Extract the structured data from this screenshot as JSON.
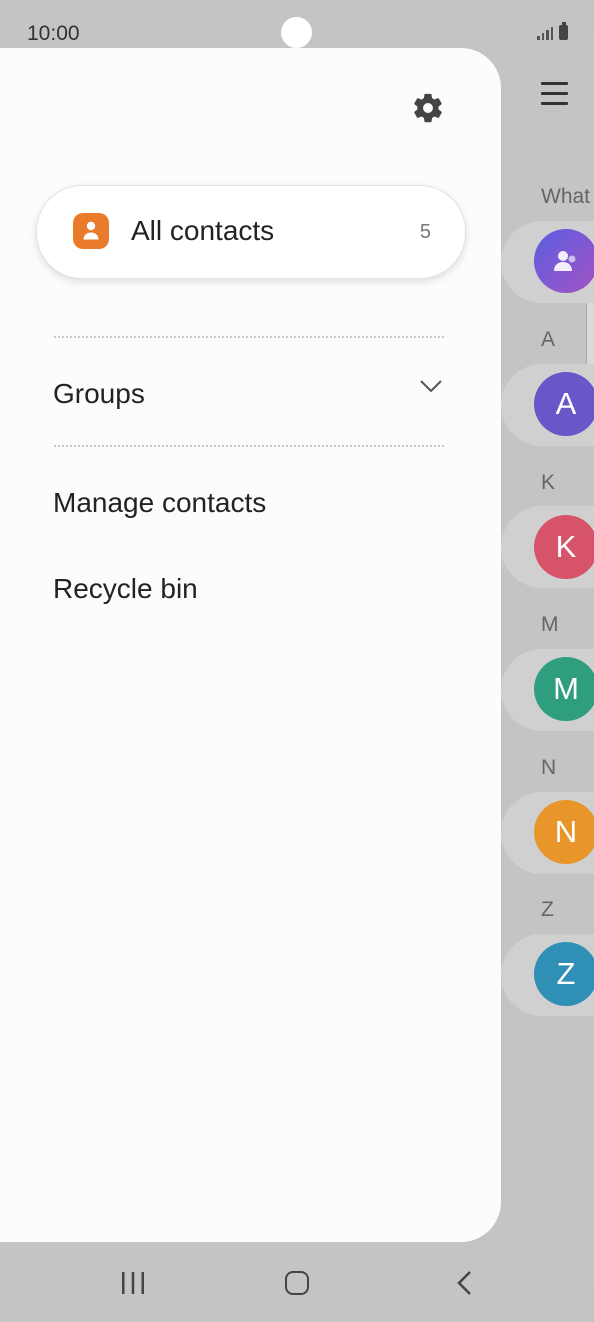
{
  "status_bar": {
    "time": "10:00"
  },
  "background_list": {
    "sections": [
      {
        "label": "What",
        "avatar_letter": "",
        "avatar_color": "#7a58cf"
      },
      {
        "label": "A",
        "avatar_letter": "A",
        "avatar_color": "#6a55c9"
      },
      {
        "label": "K",
        "avatar_letter": "K",
        "avatar_color": "#d6536a"
      },
      {
        "label": "M",
        "avatar_letter": "M",
        "avatar_color": "#2f9e7e"
      },
      {
        "label": "N",
        "avatar_letter": "N",
        "avatar_color": "#e8962a"
      },
      {
        "label": "Z",
        "avatar_letter": "Z",
        "avatar_color": "#2f8fb5"
      }
    ]
  },
  "drawer": {
    "all_contacts": {
      "label": "All contacts",
      "count": "5",
      "icon": "person-icon",
      "icon_color": "#ea7b2a"
    },
    "groups": {
      "label": "Groups",
      "icon": "chevron-down-icon"
    },
    "manage_contacts": {
      "label": "Manage contacts"
    },
    "recycle_bin": {
      "label": "Recycle bin"
    },
    "settings_icon": "gear-icon"
  },
  "navbar": {
    "recent": "recent-apps-icon",
    "home": "home-icon",
    "back": "back-icon"
  }
}
